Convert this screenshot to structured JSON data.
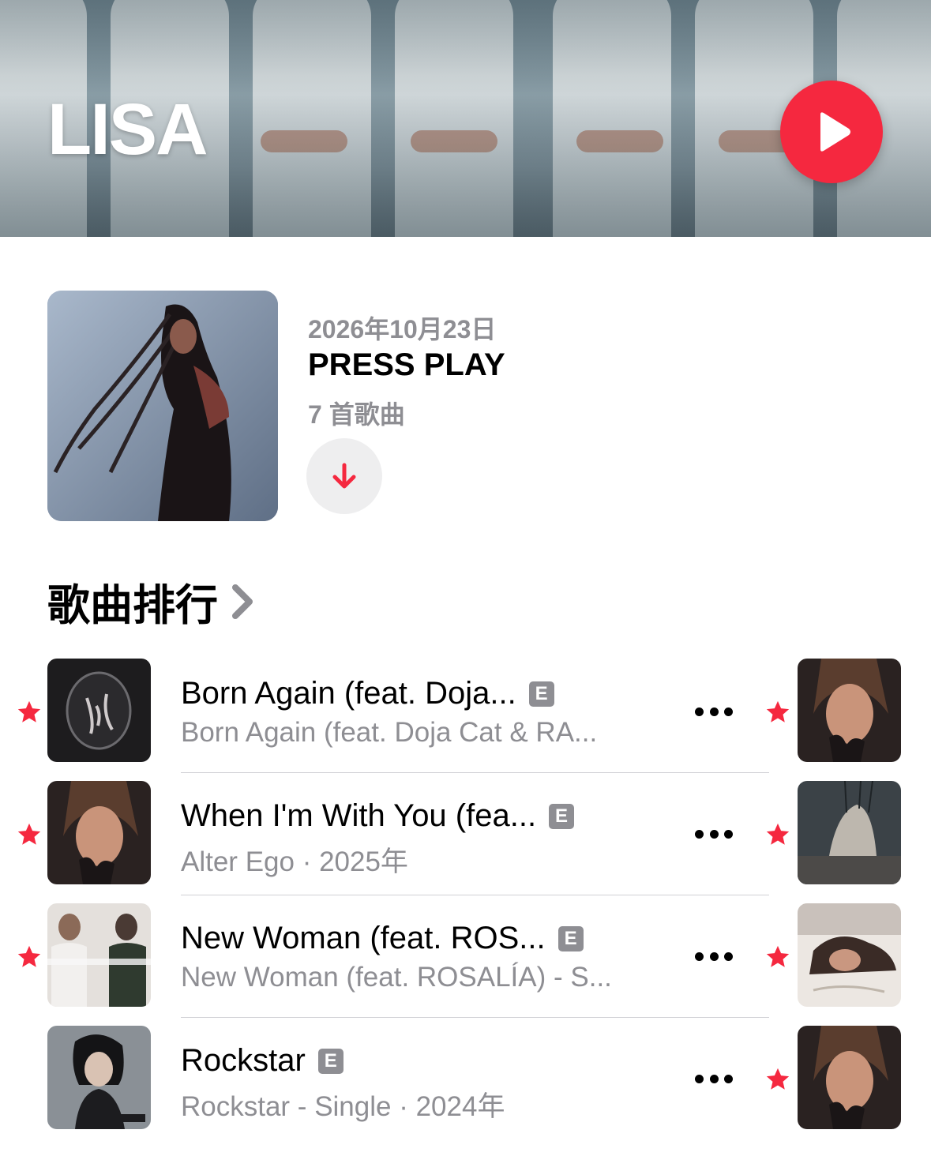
{
  "header": {
    "artist_name": "LISA",
    "play_icon": "play-icon",
    "accent_color": "#f5283f"
  },
  "latest_release": {
    "date": "2026年10月23日",
    "title": "PRESS PLAY",
    "track_count": "7 首歌曲",
    "download_icon": "download-arrow-icon"
  },
  "top_songs": {
    "heading": "歌曲排行",
    "chevron_icon": "chevron-right-icon",
    "songs": [
      {
        "title": "Born Again (feat. Doja...",
        "explicit": "E",
        "subtitle": "Born Again (feat. Doja Cat & RA..."
      },
      {
        "title": "When I'm With You (fea...",
        "explicit": "E",
        "subtitle": "Alter Ego · 2025年"
      },
      {
        "title": "New Woman (feat. ROS...",
        "explicit": "E",
        "subtitle": "New Woman (feat. ROSALÍA) - S..."
      },
      {
        "title": "Rockstar",
        "explicit": "E",
        "subtitle": "Rockstar - Single · 2024年"
      }
    ]
  }
}
